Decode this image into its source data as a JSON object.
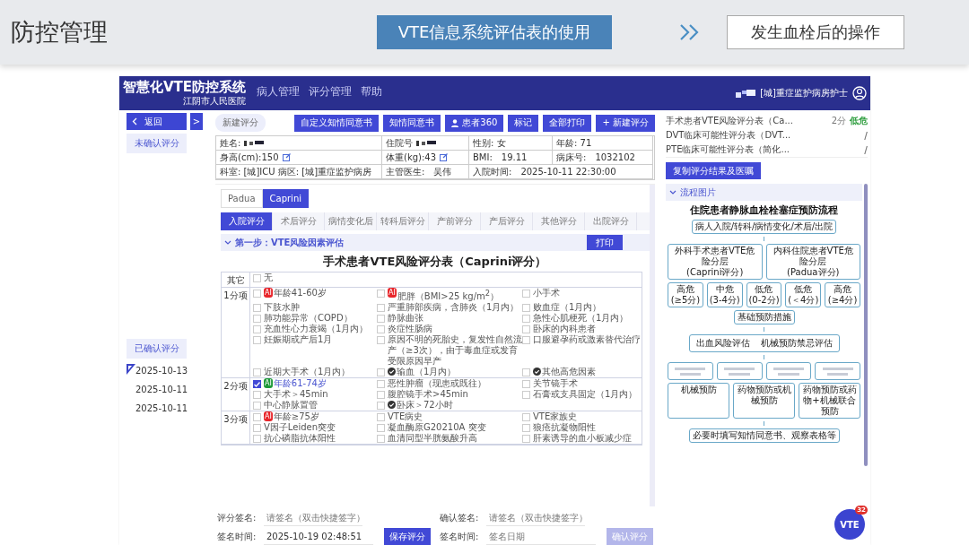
{
  "slide": {
    "title": "防控管理",
    "current_step": "VTE信息系统评估表的使用",
    "next_step": "发生血栓后的操作"
  },
  "app": {
    "name": "智慧化VTE防控系统",
    "hospital": "江阴市人民医院",
    "nav": [
      "病人管理",
      "评分管理",
      "帮助"
    ],
    "user": "[城]重症监护病房护士"
  },
  "sidebar": {
    "back": "返回",
    "expand": ">",
    "unconfirmed": "未确认评分",
    "confirmed": "已确认评分",
    "dates": [
      {
        "label": "2025-10-13",
        "selected": true
      },
      {
        "label": "2025-10-11",
        "selected": false
      },
      {
        "label": "2025-10-11",
        "selected": false
      }
    ]
  },
  "toolbar": {
    "tab": "新建评分",
    "buttons": [
      {
        "label": "自定义知情同意书",
        "kind": "plain"
      },
      {
        "label": "知情同意书",
        "kind": "plain"
      },
      {
        "label": "患者360",
        "kind": "person"
      },
      {
        "label": "标记",
        "kind": "plain"
      },
      {
        "label": "全部打印",
        "kind": "plain"
      },
      {
        "label": "+ 新建评分",
        "kind": "plain"
      }
    ]
  },
  "patient": [
    [
      {
        "label": "姓名:",
        "redacted": true
      },
      {
        "label": "住院号",
        "redacted": true
      },
      {
        "label": "性别: 女"
      },
      {
        "label": "年龄: 71"
      }
    ],
    [
      {
        "label": "身高(cm):150",
        "editable": true
      },
      {
        "label": "体重(kg):43",
        "editable": true
      },
      {
        "label": "BMI:",
        "value": "19.11"
      },
      {
        "label": "病床号:",
        "value": "1032102"
      }
    ],
    [
      {
        "label": "科室: [城]ICU 病区: [城]重症监护病房"
      },
      {
        "label": "主管医生:",
        "value": "吴伟"
      },
      {
        "label": "入院时间:",
        "value": "2025-10-11 22:30:00"
      }
    ]
  ],
  "scale_tabs": [
    {
      "label": "Padua",
      "selected": false
    },
    {
      "label": "Caprini",
      "selected": true
    }
  ],
  "stage_tabs": [
    {
      "label": "入院评分",
      "selected": true
    },
    {
      "label": "术后评分",
      "selected": false
    },
    {
      "label": "病情变化后",
      "selected": false
    },
    {
      "label": "转科后评分",
      "selected": false
    },
    {
      "label": "产前评分",
      "selected": false
    },
    {
      "label": "产后评分",
      "selected": false
    },
    {
      "label": "其他评分",
      "selected": false
    },
    {
      "label": "出院评分",
      "selected": false
    }
  ],
  "step": {
    "label": "第一步：VTE风险因素评估",
    "expanded": true,
    "print": "打印"
  },
  "form_title": "手术患者VTE风险评分表（Caprini评分）",
  "groups": [
    {
      "label": "其它",
      "items": [
        {
          "label": "无",
          "checked": false,
          "marked": false
        }
      ]
    },
    {
      "label": "1分项",
      "items": [
        {
          "label": "年龄41-60岁",
          "badge": "AI",
          "color": "#e8262b",
          "checked": false,
          "marked": false
        },
        {
          "label": "肥胖（BMI>25 kg/m$^{2}$）",
          "badge": "AI",
          "color": "#e8262b",
          "checked": false,
          "marked": false
        },
        {
          "label": "小手术",
          "checked": false,
          "marked": false
        },
        {
          "label": "下肢水肿",
          "checked": false,
          "marked": false
        },
        {
          "label": "严重肺部疾病，含肺炎（1月内）",
          "checked": false,
          "marked": false
        },
        {
          "label": "败血症（1月内）",
          "checked": false,
          "marked": false
        },
        {
          "label": "肺功能异常（COPD）",
          "checked": false,
          "marked": false
        },
        {
          "label": "静脉曲张",
          "checked": false,
          "marked": false
        },
        {
          "label": "急性心肌梗死（1月内）",
          "checked": false,
          "marked": false
        },
        {
          "label": "充血性心力衰竭（1月内）",
          "checked": false,
          "marked": false
        },
        {
          "label": "炎症性肠病",
          "checked": false,
          "marked": false
        },
        {
          "label": "卧床的内科患者",
          "checked": false,
          "marked": false
        },
        {
          "label": "妊娠期或产后1月",
          "checked": false,
          "marked": false
        },
        {
          "label": "原因不明的死胎史，复发性自然流产（≥3次），由于毒血症或发育受限原因早产",
          "checked": false,
          "marked": false
        },
        {
          "label": "口服避孕药或激素替代治疗",
          "checked": false,
          "marked": false
        },
        {
          "label": "近期大手术（1月内）",
          "checked": false,
          "marked": false
        },
        {
          "label": "输血（1月内）",
          "checked": false,
          "marked": true
        },
        {
          "label": "其他高危因素",
          "checked": false,
          "marked": true
        }
      ]
    },
    {
      "label": "2分项",
      "items": [
        {
          "label": "年龄61-74岁",
          "badge": "AI",
          "color": "#1f9a3a",
          "checked": true,
          "marked": false
        },
        {
          "label": "恶性肿瘤（现患或既往）",
          "checked": false,
          "marked": false
        },
        {
          "label": "关节镜手术",
          "checked": false,
          "marked": false
        },
        {
          "label": "大手术＞45min",
          "checked": false,
          "marked": false
        },
        {
          "label": "腹腔镜手术>45min",
          "checked": false,
          "marked": false
        },
        {
          "label": "石膏或支具固定（1月内）",
          "checked": false,
          "marked": false
        },
        {
          "label": "中心静脉置管",
          "checked": false,
          "marked": false
        },
        {
          "label": "卧床＞72小时",
          "checked": false,
          "marked": true
        }
      ]
    },
    {
      "label": "3分项",
      "items": [
        {
          "label": "年龄≥75岁",
          "badge": "AI",
          "color": "#e8262b",
          "checked": false,
          "marked": false
        },
        {
          "label": "VTE病史",
          "checked": false,
          "marked": false
        },
        {
          "label": "VTE家族史",
          "checked": false,
          "marked": false
        },
        {
          "label": "V因子Leiden突变",
          "checked": false,
          "marked": false
        },
        {
          "label": "凝血酶原G20210A 突变",
          "checked": false,
          "marked": false
        },
        {
          "label": "狼疮抗凝物阳性",
          "checked": false,
          "marked": false
        },
        {
          "label": "抗心磷脂抗体阳性",
          "checked": false,
          "marked": false
        },
        {
          "label": "血清同型半胱氨酸升高",
          "checked": false,
          "marked": false
        },
        {
          "label": "肝素诱导的血小板减少症",
          "checked": false,
          "marked": false
        }
      ]
    }
  ],
  "signature": [
    {
      "sign": {
        "label": "评分签名:",
        "placeholder": "请签名（双击快捷签字）"
      },
      "time": {
        "label": "签名时间:",
        "value": "2025-10-19 02:48:51"
      },
      "button": {
        "label": "保存评分",
        "disabled": false
      }
    },
    {
      "sign": {
        "label": "确认签名:",
        "placeholder": "请签名（双击快捷签字）"
      },
      "time": {
        "label": "签名时间:",
        "placeholder": "签名日期"
      },
      "button": {
        "label": "确认评分",
        "disabled": true
      }
    }
  ],
  "scores": [
    {
      "name": "手术患者VTE风险评分表（Ca...",
      "score": "2分",
      "result": "低危",
      "color": "#2f9e3f"
    },
    {
      "name": "DVT临床可能性评分表（DVT...",
      "result": "/"
    },
    {
      "name": "PTE临床可能性评分表（简化...",
      "result": "/"
    }
  ],
  "copy_button": "复制评分结果及医嘱",
  "flow_section": {
    "label": "流程图片",
    "expanded": true
  },
  "flowchart": {
    "title": "住院患者静脉血栓栓塞症预防流程",
    "start": "病人入院/转科/病情变化/术后/出院",
    "tiers": [
      {
        "label": "外科手术患者VTE危险分层",
        "sub": "(Caprini评分)"
      },
      {
        "label": "内科住院患者VTE危险分层",
        "sub": "(Padua评分)"
      }
    ],
    "levels": [
      {
        "label": "高危",
        "range": "(≥5分)"
      },
      {
        "label": "中危",
        "range": "(3-4分)"
      },
      {
        "label": "低危",
        "range": "(0-2分)"
      },
      {
        "label": "低危",
        "range": "(＜4分)"
      },
      {
        "label": "高危",
        "range": "(≥4分)"
      }
    ],
    "basic": "基础预防措施",
    "assess": [
      "出血风险评估",
      "机械预防禁忌评估"
    ],
    "measures": [
      "机械预防",
      "药物预防或机械预防",
      "药物预防或药物+机械联合预防"
    ],
    "final": "必要时填写知情同意书、观察表格等"
  },
  "float_button": {
    "label": "VTE",
    "count": "32"
  }
}
